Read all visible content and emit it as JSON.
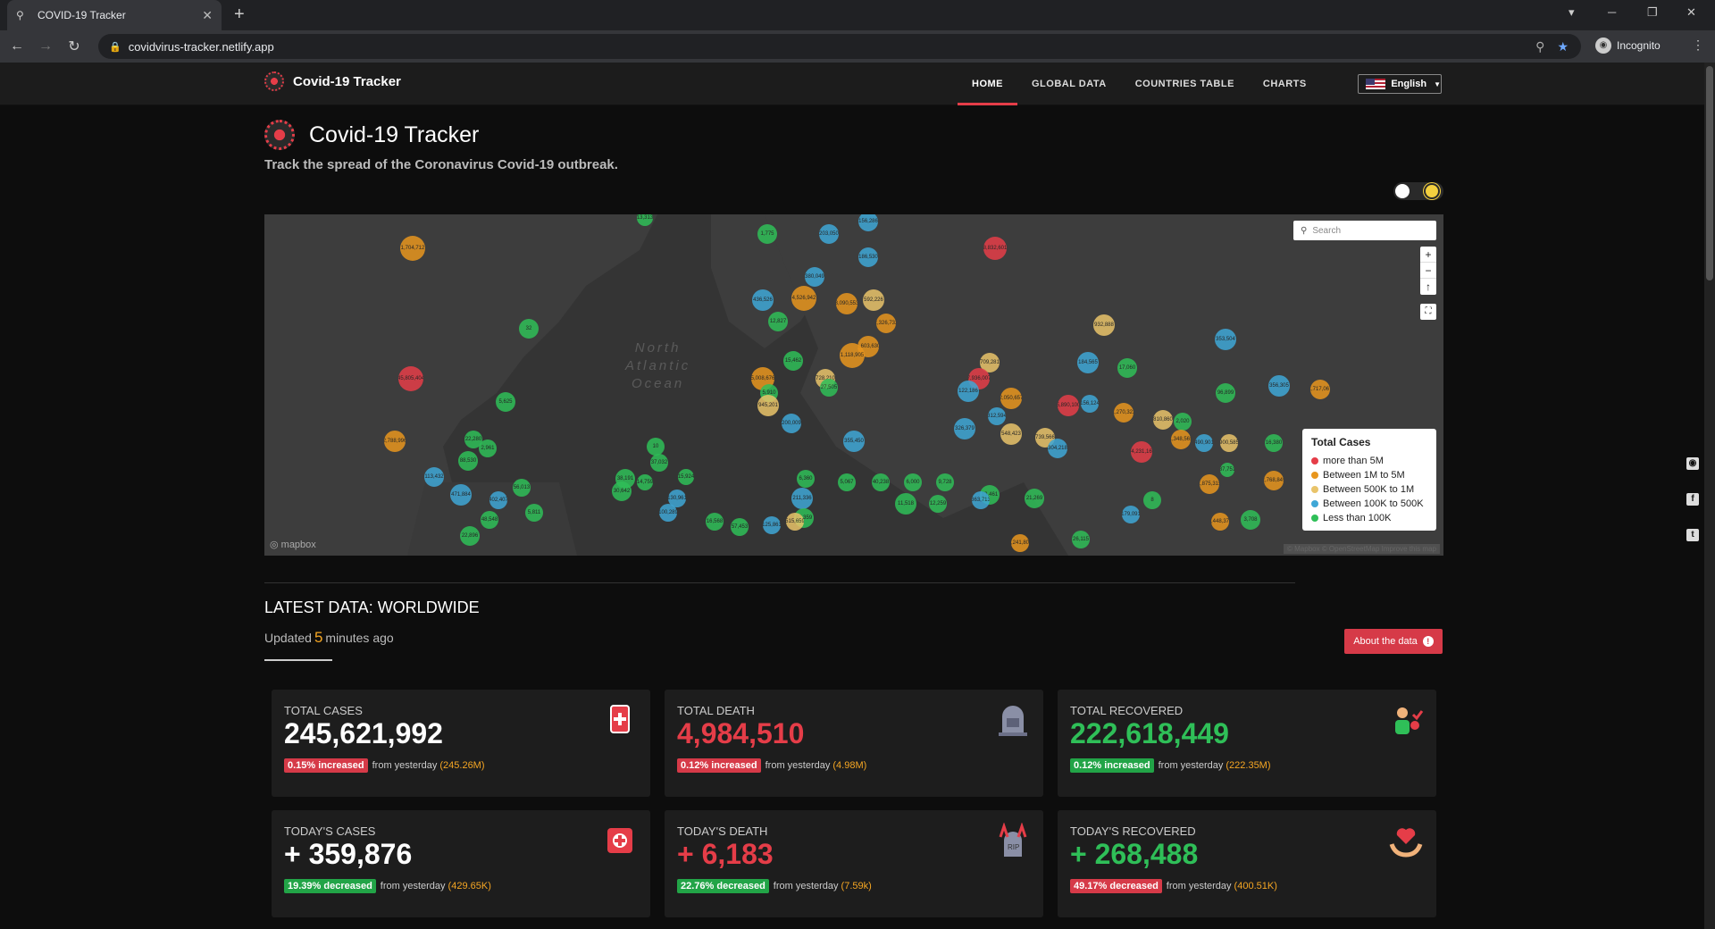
{
  "browser": {
    "tab_title": "COVID-19 Tracker",
    "url": "covidvirus-tracker.netlify.app",
    "profile": "Incognito"
  },
  "nav": {
    "brand": "Covid-19 Tracker",
    "items": [
      "HOME",
      "GLOBAL DATA",
      "COUNTRIES TABLE",
      "CHARTS"
    ],
    "language": "English"
  },
  "hero": {
    "title": "Covid-19 Tracker",
    "subtitle": "Track the spread of the Coronavirus Covid-19 outbreak."
  },
  "map": {
    "search_placeholder": "Search",
    "ocean_label": [
      "North",
      "Atlantic",
      "Ocean"
    ],
    "attribution": "mapbox",
    "attribution_right": "© Mapbox © OpenStreetMap Improve this map",
    "legend": {
      "title": "Total Cases",
      "items": [
        {
          "label": "more than 5M",
          "color": "#e53d48"
        },
        {
          "label": "Between 1M to 5M",
          "color": "#e8961e"
        },
        {
          "label": "Between 500K to 1M",
          "color": "#e9c46a"
        },
        {
          "label": "Between 100K to 500K",
          "color": "#3fa7d6"
        },
        {
          "label": "Less than 100K",
          "color": "#2fbf58"
        }
      ]
    },
    "bubbles": [
      {
        "label": "13,313",
        "c": "#2fbf58"
      },
      {
        "label": "1,775",
        "c": "#2fbf58"
      },
      {
        "label": "203,050",
        "c": "#3fa7d6"
      },
      {
        "label": "156,286",
        "c": "#3fa7d6"
      },
      {
        "label": "1,704,712",
        "c": "#e8961e"
      },
      {
        "label": "8,832,601",
        "c": "#e53d48"
      },
      {
        "label": "186,530",
        "c": "#3fa7d6"
      },
      {
        "label": "380,049",
        "c": "#3fa7d6"
      },
      {
        "label": "436,526",
        "c": "#3fa7d6"
      },
      {
        "label": "4,526,942",
        "c": "#e8961e"
      },
      {
        "label": "3,090,553",
        "c": "#e8961e"
      },
      {
        "label": "592,226",
        "c": "#e9c46a"
      },
      {
        "label": "12,827",
        "c": "#2fbf58"
      },
      {
        "label": "2,326,732",
        "c": "#e8961e"
      },
      {
        "label": "32",
        "c": "#2fbf58"
      },
      {
        "label": "932,888",
        "c": "#e9c46a"
      },
      {
        "label": "353,504",
        "c": "#3fa7d6"
      },
      {
        "label": "1,603,630",
        "c": "#e8961e"
      },
      {
        "label": "1,118,905",
        "c": "#e8961e"
      },
      {
        "label": "709,281",
        "c": "#e9c46a"
      },
      {
        "label": "184,565",
        "c": "#3fa7d6"
      },
      {
        "label": "45,805,404",
        "c": "#e53d48"
      },
      {
        "label": "5,008,676",
        "c": "#e8961e"
      },
      {
        "label": "15,462",
        "c": "#2fbf58"
      },
      {
        "label": "728,210",
        "c": "#e9c46a"
      },
      {
        "label": "7,936,007",
        "c": "#e53d48"
      },
      {
        "label": "17,060",
        "c": "#2fbf58"
      },
      {
        "label": "356,305",
        "c": "#3fa7d6"
      },
      {
        "label": "1,717,067",
        "c": "#e8961e"
      },
      {
        "label": "96,899",
        "c": "#2fbf58"
      },
      {
        "label": "5,625",
        "c": "#2fbf58"
      },
      {
        "label": "5,910",
        "c": "#2fbf58"
      },
      {
        "label": "27,505",
        "c": "#2fbf58"
      },
      {
        "label": "122,186",
        "c": "#3fa7d6"
      },
      {
        "label": "2,050,657",
        "c": "#e8961e"
      },
      {
        "label": "5,890,100",
        "c": "#e53d48"
      },
      {
        "label": "156,124",
        "c": "#3fa7d6"
      },
      {
        "label": "1,270,322",
        "c": "#e8961e"
      },
      {
        "label": "945,201",
        "c": "#e9c46a"
      },
      {
        "label": "200,009",
        "c": "#3fa7d6"
      },
      {
        "label": "312,594",
        "c": "#3fa7d6"
      },
      {
        "label": "810,860",
        "c": "#e9c46a"
      },
      {
        "label": "2,020",
        "c": "#2fbf58"
      },
      {
        "label": "326,379",
        "c": "#3fa7d6"
      },
      {
        "label": "548,423",
        "c": "#e9c46a"
      },
      {
        "label": "739,566",
        "c": "#e9c46a"
      },
      {
        "label": "1,348,565",
        "c": "#e8961e"
      },
      {
        "label": "2,788,996",
        "c": "#e8961e"
      },
      {
        "label": "22,280",
        "c": "#2fbf58"
      },
      {
        "label": "355,450",
        "c": "#3fa7d6"
      },
      {
        "label": "304,218",
        "c": "#3fa7d6"
      },
      {
        "label": "34,231,163",
        "c": "#e53d48"
      },
      {
        "label": "490,901",
        "c": "#3fa7d6"
      },
      {
        "label": "900,585",
        "c": "#e9c46a"
      },
      {
        "label": "16,380",
        "c": "#2fbf58"
      },
      {
        "label": "2,961",
        "c": "#2fbf58"
      },
      {
        "label": "88,530",
        "c": "#2fbf58"
      },
      {
        "label": "10",
        "c": "#2fbf58"
      },
      {
        "label": "37,032",
        "c": "#2fbf58"
      },
      {
        "label": "113,432",
        "c": "#3fa7d6"
      },
      {
        "label": "6,360",
        "c": "#2fbf58"
      },
      {
        "label": "5,067",
        "c": "#2fbf58"
      },
      {
        "label": "40,238",
        "c": "#2fbf58"
      },
      {
        "label": "6,000",
        "c": "#2fbf58"
      },
      {
        "label": "9,728",
        "c": "#2fbf58"
      },
      {
        "label": "1,875,315",
        "c": "#e8961e"
      },
      {
        "label": "37,751",
        "c": "#2fbf58"
      },
      {
        "label": "2,768,849",
        "c": "#e8961e"
      },
      {
        "label": "38,191",
        "c": "#2fbf58"
      },
      {
        "label": "15,924",
        "c": "#2fbf58"
      },
      {
        "label": "471,884",
        "c": "#3fa7d6"
      },
      {
        "label": "56,013",
        "c": "#2fbf58"
      },
      {
        "label": "30,642",
        "c": "#2fbf58"
      },
      {
        "label": "14,759",
        "c": "#2fbf58"
      },
      {
        "label": "13,461",
        "c": "#2fbf58"
      },
      {
        "label": "21,269",
        "c": "#2fbf58"
      },
      {
        "label": "402,407",
        "c": "#3fa7d6"
      },
      {
        "label": "211,336",
        "c": "#3fa7d6"
      },
      {
        "label": "130,961",
        "c": "#3fa7d6"
      },
      {
        "label": "11,518",
        "c": "#2fbf58"
      },
      {
        "label": "12,259",
        "c": "#2fbf58"
      },
      {
        "label": "363,713",
        "c": "#3fa7d6"
      },
      {
        "label": "538,186",
        "c": "#e9c46a"
      },
      {
        "label": "8",
        "c": "#2fbf58"
      },
      {
        "label": "4,994,014",
        "c": "#e8961e"
      },
      {
        "label": "48,548",
        "c": "#2fbf58"
      },
      {
        "label": "5,811",
        "c": "#2fbf58"
      },
      {
        "label": "100,289",
        "c": "#3fa7d6"
      },
      {
        "label": "87,359",
        "c": "#2fbf58"
      },
      {
        "label": "179,091",
        "c": "#3fa7d6"
      },
      {
        "label": "2,448,372",
        "c": "#e8961e"
      },
      {
        "label": "3,708",
        "c": "#2fbf58"
      },
      {
        "label": "16,568",
        "c": "#2fbf58"
      },
      {
        "label": "57,453",
        "c": "#2fbf58"
      },
      {
        "label": "125,861",
        "c": "#3fa7d6"
      },
      {
        "label": "515,659",
        "c": "#e9c46a"
      },
      {
        "label": "22,896",
        "c": "#2fbf58"
      },
      {
        "label": "26,115",
        "c": "#2fbf58"
      },
      {
        "label": "4,241,809",
        "c": "#e8961e"
      }
    ]
  },
  "latest": {
    "title": "LATEST DATA: WORLDWIDE",
    "updated_prefix": "Updated",
    "updated_num": "5",
    "updated_suffix": "minutes ago",
    "about_button": "About the data",
    "from_yesterday": "from yesterday",
    "cards": [
      {
        "label": "TOTAL CASES",
        "value": "245,621,992",
        "badge": "0.15% increased",
        "badge_kind": "red",
        "prev": "(245.26M)",
        "value_color": "white",
        "icon": "blood-bag-icon"
      },
      {
        "label": "TOTAL DEATH",
        "value": "4,984,510",
        "badge": "0.12% increased",
        "badge_kind": "red",
        "prev": "(4.98M)",
        "value_color": "red",
        "icon": "tombstone-icon"
      },
      {
        "label": "TOTAL RECOVERED",
        "value": "222,618,449",
        "badge": "0.12% increased",
        "badge_kind": "green",
        "prev": "(222.35M)",
        "value_color": "green",
        "icon": "recovered-person-icon"
      },
      {
        "label": "TODAY'S CASES",
        "value": "+ 359,876",
        "badge": "19.39% decreased",
        "badge_kind": "green",
        "prev": "(429.65K)",
        "value_color": "white",
        "icon": "first-aid-icon"
      },
      {
        "label": "TODAY'S DEATH",
        "value": "+ 6,183",
        "badge": "22.76% decreased",
        "badge_kind": "green",
        "prev": "(7.59k)",
        "value_color": "red",
        "icon": "rip-icon"
      },
      {
        "label": "TODAY'S RECOVERED",
        "value": "+ 268,488",
        "badge": "49.17% decreased",
        "badge_kind": "red",
        "prev": "(400.51K)",
        "value_color": "green",
        "icon": "heart-hands-icon"
      }
    ]
  }
}
